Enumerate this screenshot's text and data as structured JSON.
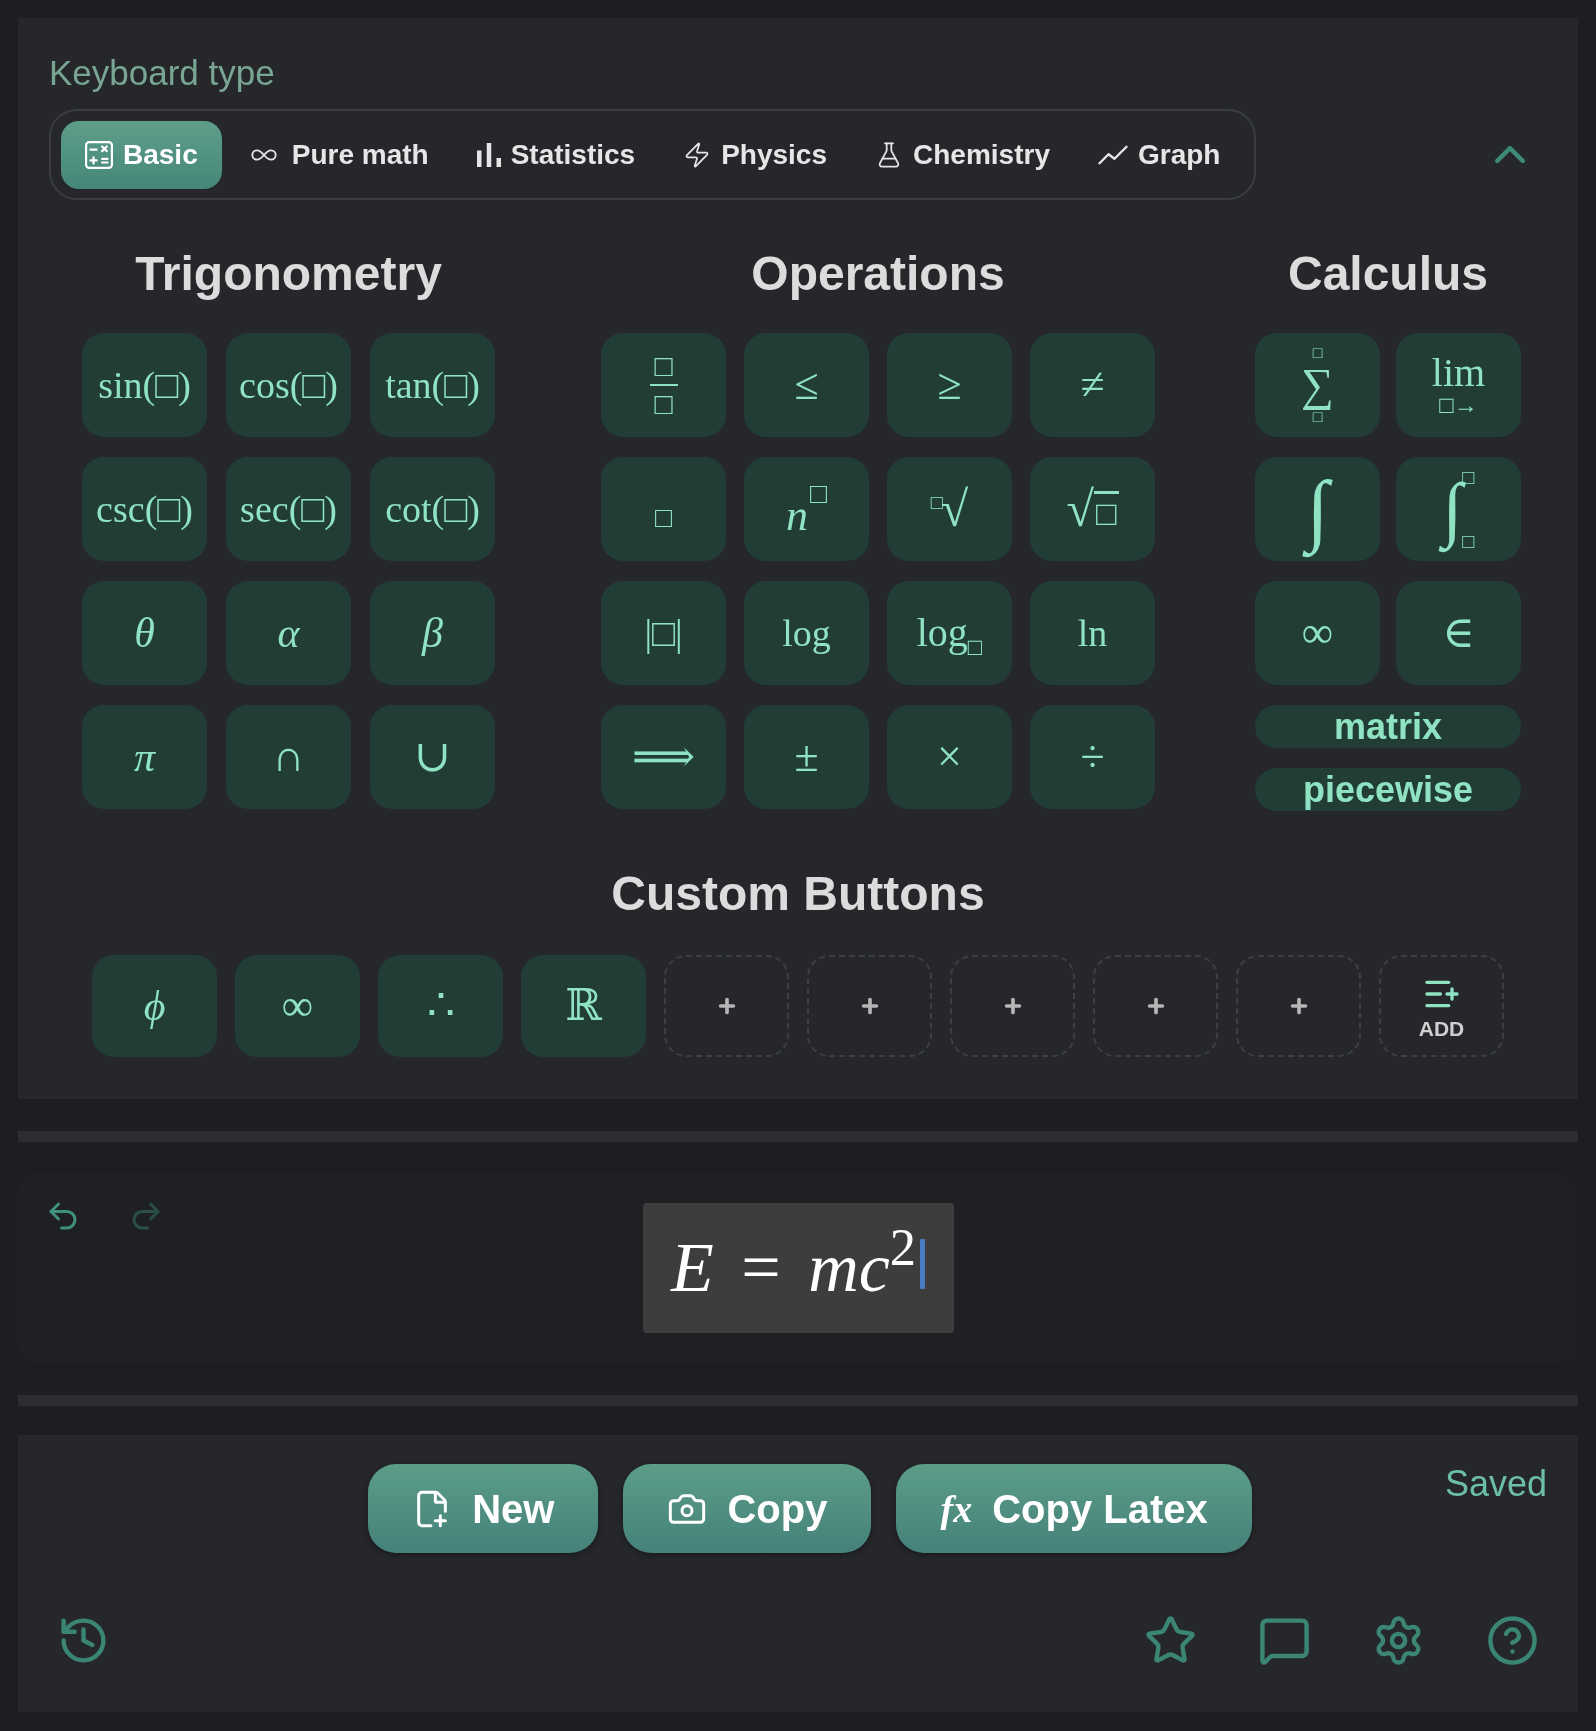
{
  "keyboard": {
    "label": "Keyboard type",
    "expanded": true,
    "tabs": [
      {
        "label": "Basic",
        "selected": true
      },
      {
        "label": "Pure math",
        "selected": false
      },
      {
        "label": "Statistics",
        "selected": false
      },
      {
        "label": "Physics",
        "selected": false
      },
      {
        "label": "Chemistry",
        "selected": false
      },
      {
        "label": "Graph",
        "selected": false
      }
    ],
    "sections": [
      {
        "title": "Trigonometry",
        "keys": [
          {
            "kind": "function",
            "label": "sin(□)"
          },
          {
            "kind": "function",
            "label": "cos(□)"
          },
          {
            "kind": "function",
            "label": "tan(□)"
          },
          {
            "kind": "function",
            "label": "csc(□)"
          },
          {
            "kind": "function",
            "label": "sec(□)"
          },
          {
            "kind": "function",
            "label": "cot(□)"
          },
          {
            "kind": "variable",
            "label": "θ"
          },
          {
            "kind": "variable",
            "label": "α"
          },
          {
            "kind": "variable",
            "label": "β"
          },
          {
            "kind": "variable",
            "label": "π"
          },
          {
            "kind": "symbol",
            "label": "∩"
          },
          {
            "kind": "symbol",
            "label": "∪"
          }
        ]
      },
      {
        "title": "Operations",
        "keys": [
          {
            "kind": "fraction",
            "numerator": "□",
            "denominator": "□"
          },
          {
            "kind": "symbol",
            "label": "≤"
          },
          {
            "kind": "symbol",
            "label": "≥"
          },
          {
            "kind": "symbol",
            "label": "≠"
          },
          {
            "kind": "placeholder",
            "label": "□"
          },
          {
            "kind": "power",
            "base": "n",
            "exponent": "□"
          },
          {
            "kind": "nth_root",
            "index": "□",
            "radical": "√"
          },
          {
            "kind": "sqrt",
            "radical": "√",
            "radicand": "□"
          },
          {
            "kind": "function",
            "label": "|□|"
          },
          {
            "kind": "function",
            "label": "log"
          },
          {
            "kind": "subscript",
            "base": "log",
            "subscript": "□"
          },
          {
            "kind": "function",
            "label": "ln"
          },
          {
            "kind": "symbol",
            "label": "⟹"
          },
          {
            "kind": "symbol",
            "label": "±"
          },
          {
            "kind": "symbol",
            "label": "×"
          },
          {
            "kind": "symbol",
            "label": "÷"
          }
        ]
      },
      {
        "title": "Calculus",
        "keys": [
          {
            "kind": "sum",
            "symbol": "∑",
            "upper": "□",
            "lower": "□"
          },
          {
            "kind": "limit",
            "label": "lim",
            "under": "□→"
          },
          {
            "kind": "integral",
            "symbol": "∫"
          },
          {
            "kind": "definite_integral",
            "symbol": "∫",
            "upper": "□",
            "lower": "□"
          },
          {
            "kind": "symbol",
            "label": "∞"
          },
          {
            "kind": "symbol",
            "label": "∈"
          },
          {
            "kind": "wide",
            "label": "matrix"
          },
          {
            "kind": "wide",
            "label": "piecewise"
          }
        ]
      }
    ],
    "custom": {
      "title": "Custom Buttons",
      "keys": [
        {
          "kind": "variable",
          "label": "ϕ"
        },
        {
          "kind": "symbol",
          "label": "∞"
        },
        {
          "kind": "symbol",
          "label": "∴"
        },
        {
          "kind": "symbol",
          "label": "ℝ"
        },
        {
          "kind": "empty"
        },
        {
          "kind": "empty"
        },
        {
          "kind": "empty"
        },
        {
          "kind": "empty"
        },
        {
          "kind": "empty"
        },
        {
          "kind": "add",
          "label": "ADD"
        }
      ]
    }
  },
  "editor": {
    "undo": {
      "disabled": false
    },
    "redo": {
      "disabled": true
    },
    "math_field": {
      "value": "*E* = *mc*$^{2}$",
      "focused": true
    }
  },
  "actions": {
    "buttons": [
      {
        "label": "New"
      },
      {
        "label": "Copy"
      },
      {
        "label": "Copy Latex",
        "glyph": "fx"
      }
    ],
    "status": "Saved"
  }
}
